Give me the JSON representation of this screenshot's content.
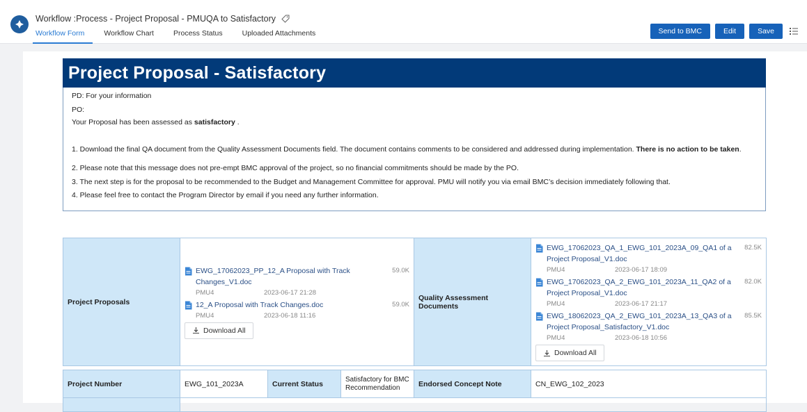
{
  "header": {
    "title": "Workflow :Process - Project Proposal - PMUQA to Satisfactory",
    "tabs": [
      "Workflow Form",
      "Workflow Chart",
      "Process Status",
      "Uploaded Attachments"
    ],
    "buttons": {
      "send": "Send to BMC",
      "edit": "Edit",
      "save": "Save"
    }
  },
  "form": {
    "banner": "Project Proposal - Satisfactory",
    "message": {
      "pd": "PD: For your information",
      "po": "PO:",
      "assessed_prefix": "Your Proposal has been assessed as ",
      "assessed_bold": "satisfactory",
      "assessed_suffix": " .",
      "item1_prefix": "1. Download the final QA document from the Quality Assessment Documents field. The document contains comments to be considered and addressed during implementation. ",
      "item1_bold": "There is no action to be taken",
      "item1_suffix": ".",
      "item2": "2. Please note that this message does not pre-empt BMC approval of the project, so no financial commitments should be made by the PO.",
      "item3": "3. The next step is for the proposal to be recommended to the Budget and Management Committee for approval. PMU will notify you via email BMC’s decision immediately following that.",
      "item4": "4. Please feel free to contact the Program Director by email if you need any further information."
    },
    "proposals": {
      "label": "Project Proposals",
      "files": [
        {
          "name": "EWG_17062023_PP_12_A Proposal with Track Changes_V1.doc",
          "size": "59.0K",
          "user": "PMU4",
          "date": "2023-06-17 21:28"
        },
        {
          "name": "12_A Proposal with Track Changes.doc",
          "size": "59.0K",
          "user": "PMU4",
          "date": "2023-06-18 11:16"
        }
      ],
      "download_all": "Download All"
    },
    "qa": {
      "label": "Quality Assessment Documents",
      "files": [
        {
          "name": "EWG_17062023_QA_1_EWG_101_2023A_09_QA1 of a Project Proposal_V1.doc",
          "size": "82.5K",
          "user": "PMU4",
          "date": "2023-06-17 18:09"
        },
        {
          "name": "EWG_17062023_QA_2_EWG_101_2023A_11_QA2 of a Project Proposal_V1.doc",
          "size": "82.0K",
          "user": "PMU4",
          "date": "2023-06-17 21:17"
        },
        {
          "name": "EWG_18062023_QA_2_EWG_101_2023A_13_QA3 of a Project Proposal_Satisfactory_V1.doc",
          "size": "85.5K",
          "user": "PMU4",
          "date": "2023-06-18 10:56"
        }
      ],
      "download_all": "Download All"
    },
    "row2": {
      "project_number_label": "Project Number",
      "project_number": "EWG_101_2023A",
      "current_status_label": "Current Status",
      "current_status": "Satisfactory for BMC Recommendation",
      "concept_note_label": "Endorsed Concept Note",
      "concept_note": "CN_EWG_102_2023"
    }
  },
  "colors": {
    "banner": "#023a79",
    "label_cell": "#cfe7f8",
    "primary_button": "#1762b9",
    "active_tab": "#2a7bd3"
  },
  "icons": [
    "app-logo-icon",
    "tag-icon",
    "list-menu-icon",
    "document-icon",
    "download-icon"
  ]
}
